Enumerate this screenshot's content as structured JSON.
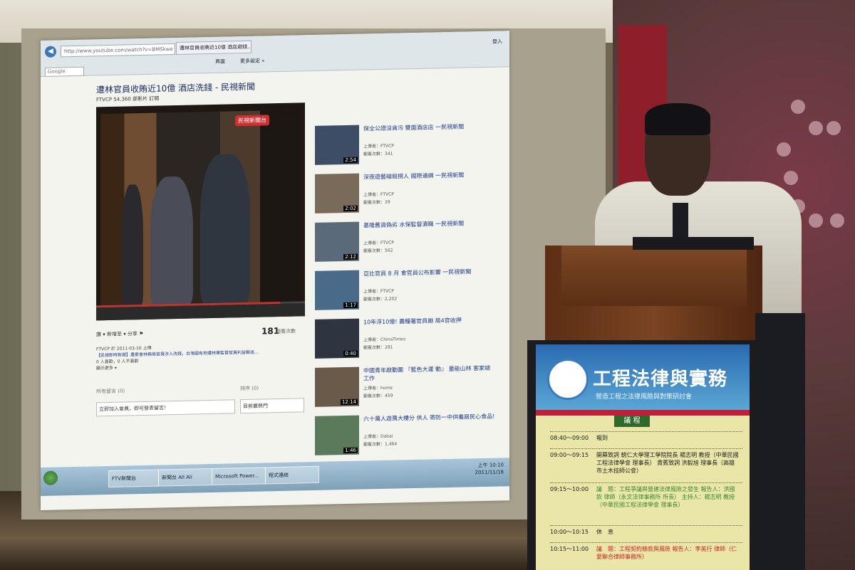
{
  "browser": {
    "address": "http://www.youtube.com/watch?v=BMSkwe",
    "tab_label": "遭林官員收賄近10億 酒店避錢...",
    "menu_page": "頁面",
    "menu_more": "更多設定 »",
    "login": "登入",
    "search_placeholder": "Google"
  },
  "video": {
    "title": "遭林官員收賄近10億 酒店洗錢 - 民視新聞",
    "channel": "FTVCP",
    "channel_count": "54,360 部影片",
    "subscribe": "訂閱",
    "logo": "民視新聞台",
    "progress_fraction": 0.88,
    "actions": "讚  ▾  新增至 ▾  分享  ⚑",
    "views": "181",
    "views_label": "觀看次數",
    "upload_info": "FTVCP 於 2011-03-10 上傳",
    "description": "【民視即時新聞】農委會林務局官員涉入洗錢，台灣國有地遭林業監督官員利益輸送...",
    "likes": "0 人喜歡，0 人不喜歡",
    "show_more": "顯示更多 ▾",
    "all_comments": "所有留言 (0)",
    "comment_placeholder": "立即加入會員，即可發表留言！",
    "sort_label": "排序 (0)",
    "sort_value": "目前最熱門"
  },
  "related": [
    {
      "title": "保全公證沒貪污 雙面酒店店 一民視新聞",
      "uploader": "上傳者：FTVCP",
      "views": "觀看次數：341",
      "duration": "2:54"
    },
    {
      "title": "深夜遊藝暗殺撈人 國際通緝 一民視新聞",
      "uploader": "上傳者：FTVCP",
      "views": "觀看次數：39",
      "duration": "2:02"
    },
    {
      "title": "基隆舊貨偽劣 水保監督瀆職 一民視新聞",
      "uploader": "上傳者：FTVCP",
      "views": "觀看次數：562",
      "duration": "2:12"
    },
    {
      "title": "亞比官員 8 月 會官員公布影響 一民視新聞",
      "uploader": "上傳者：FTVCP",
      "views": "觀看次數：2,202",
      "duration": "1:17"
    },
    {
      "title": "10年浮10億! 農糧署官員飽 局4官收押",
      "uploader": "上傳者：ChinaTimes",
      "views": "觀看次數：281",
      "duration": "0:40"
    },
    {
      "title": "中國青年啟動圖 『藍色大運 動』 量能山林 客家總工作",
      "uploader": "上傳者：home",
      "views": "觀看次數：459",
      "duration": "12:14"
    },
    {
      "title": "六十萬人遊萬大樓分 供人 寄防一中供養居民心食品!",
      "uploader": "上傳者：Dabai",
      "views": "觀看次數：1,464",
      "duration": "1:46"
    }
  ],
  "taskbar": {
    "items": [
      "FTV新聞台",
      "新聞台 All Ali",
      "Microsoft Power...",
      "程式連結"
    ],
    "time": "上午 10:10",
    "date": "2011/11/18"
  },
  "sign": {
    "title": "工程法律與實務",
    "subtitle": "營造工程之法律風險與對策研討會",
    "agenda_header": "議 程",
    "rows": [
      {
        "time": "08:40～09:00",
        "content": "報到"
      },
      {
        "time": "09:00～09:15",
        "content": "開幕致詞 朝仁大學理工學院院長 楊志明 教授（中華民國工程法律學會 理事長） 貴賓致詞 洪毅旭 理事長（高雄市土木技師公會）"
      },
      {
        "time": "09:15～10:00",
        "content": "議　題：工程爭議與營建法律風險之發生 報告人：洪國欽 律師（永文法律事務所 所長） 主持人：楊志明 教授（中華民國工程法律學會 理事長）"
      },
      {
        "time": "10:00～10:15",
        "content": "休　息"
      },
      {
        "time": "10:15～11:00",
        "content": "議　題：工程契約條款與風險 報告人：李英行 律師（仁愛聯合律師事務所）"
      }
    ]
  }
}
